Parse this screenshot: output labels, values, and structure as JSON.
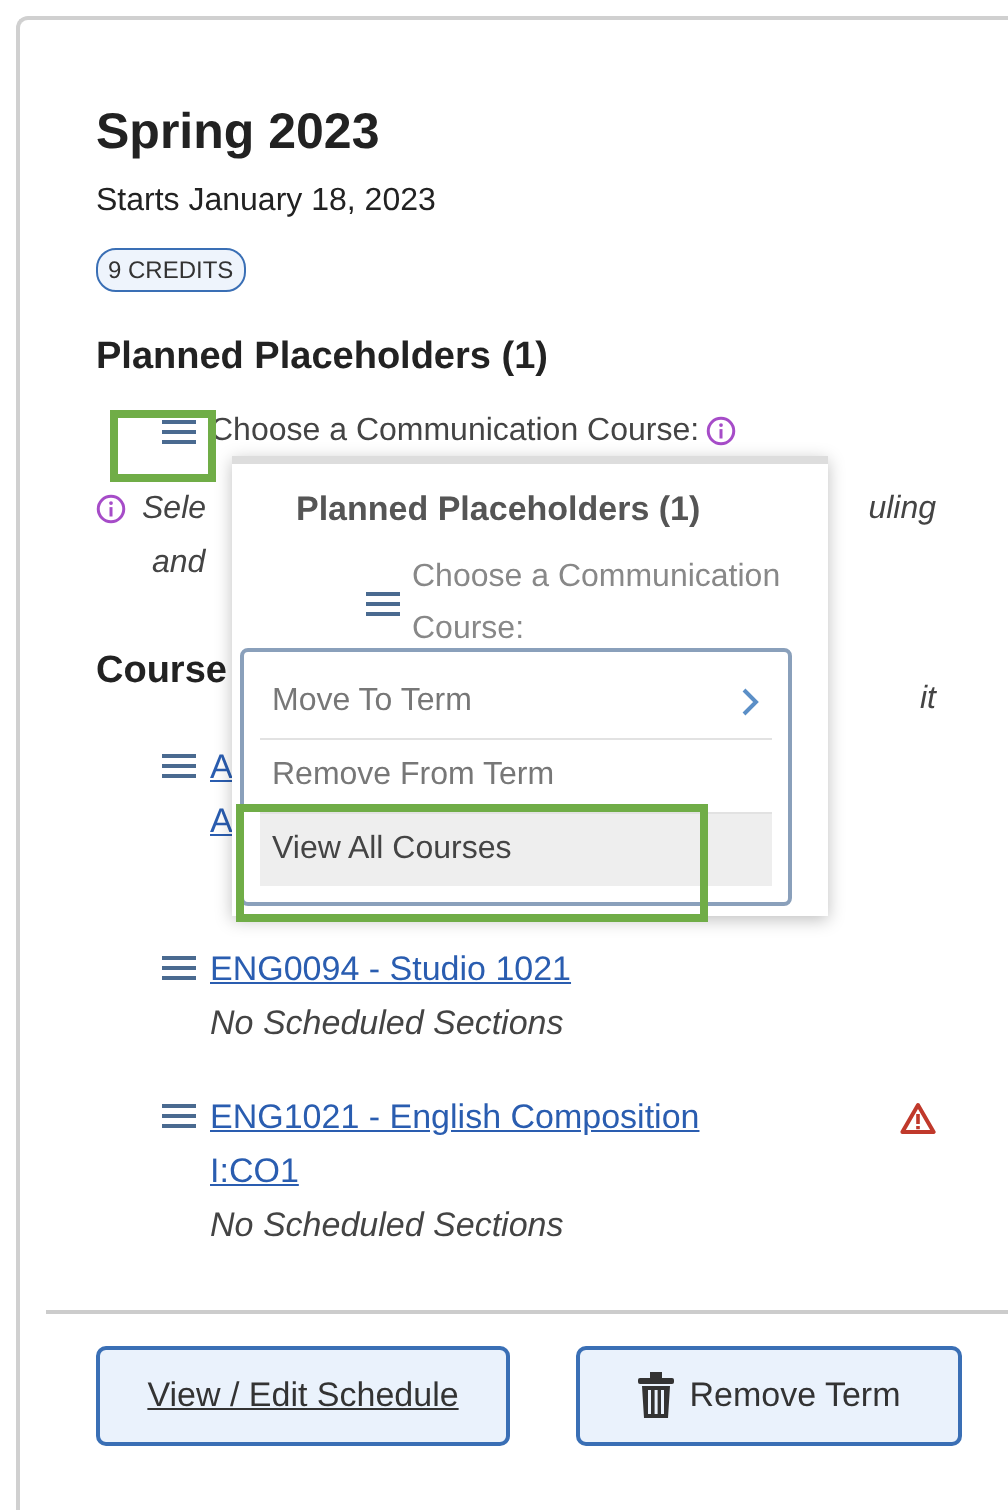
{
  "term": {
    "title": "Spring 2023",
    "starts": "Starts January 18, 2023",
    "credits_badge": "9 CREDITS"
  },
  "placeholders": {
    "heading": "Planned Placeholders (1)",
    "items": [
      {
        "label": "Choose a Communication Course:",
        "highlighted": true,
        "info_line_1_start": "Sele",
        "info_line_1_end": "uling",
        "info_line_2": "and"
      }
    ]
  },
  "courses": {
    "heading": "Course",
    "items": [
      {
        "title_lines": [
          "A",
          "A"
        ],
        "note": "it",
        "warning": false
      },
      {
        "title_lines": [
          "ENG0094 - Studio 1021"
        ],
        "status": "No Scheduled Sections",
        "warning": false
      },
      {
        "title_lines": [
          "ENG1021 - English Composition",
          "I:CO1"
        ],
        "status": "No Scheduled Sections",
        "warning": true
      }
    ]
  },
  "popup": {
    "heading": "Planned Placeholders (1)",
    "item": "Choose a Communication Course:",
    "menu": [
      {
        "label": "Move To Term",
        "submenu": true,
        "selected": false,
        "highlighted": false
      },
      {
        "label": "Remove From Term",
        "submenu": false,
        "selected": false,
        "highlighted": false
      },
      {
        "label": "View All Courses",
        "submenu": false,
        "selected": true,
        "highlighted": true
      }
    ]
  },
  "buttons": [
    {
      "label": "View / Edit Schedule",
      "kind": "link"
    },
    {
      "label": "Remove Term",
      "kind": "trash"
    }
  ]
}
